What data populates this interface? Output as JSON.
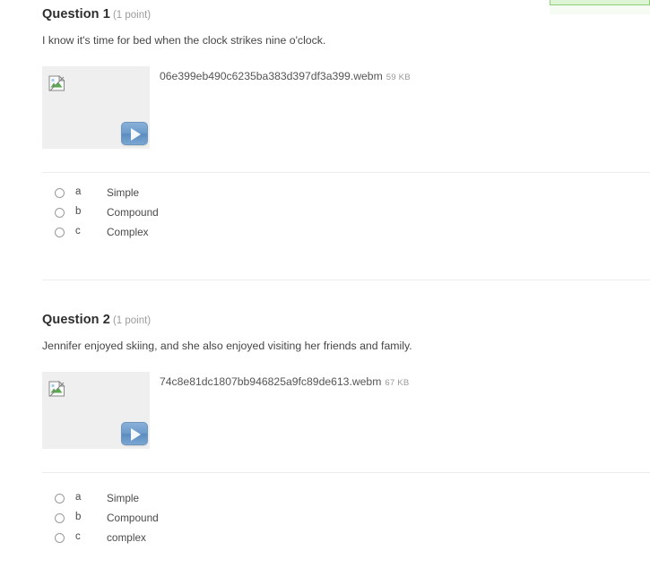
{
  "banner": {
    "color": "#ddf5d4",
    "border_color": "#8fce79"
  },
  "questions": [
    {
      "title": "Question 1",
      "points": "(1 point)",
      "prompt": "I know it's time for bed when the clock strikes nine o'clock.",
      "attachment": {
        "file_name": "06e399eb490c6235ba383d397df3a399.webm",
        "file_size": "59 KB",
        "thumbnail_icon": "broken-image-icon",
        "play_icon": "play-icon"
      },
      "options": [
        {
          "letter": "a",
          "text": "Simple",
          "selected": false
        },
        {
          "letter": "b",
          "text": "Compound",
          "selected": false
        },
        {
          "letter": "c",
          "text": "Complex",
          "selected": false
        }
      ]
    },
    {
      "title": "Question 2",
      "points": "(1 point)",
      "prompt": "Jennifer enjoyed skiing, and she also enjoyed visiting her friends and family.",
      "attachment": {
        "file_name": "74c8e81dc1807bb946825a9fc89de613.webm",
        "file_size": "67 KB",
        "thumbnail_icon": "broken-image-icon",
        "play_icon": "play-icon"
      },
      "options": [
        {
          "letter": "a",
          "text": "Simple",
          "selected": false
        },
        {
          "letter": "b",
          "text": "Compound",
          "selected": false
        },
        {
          "letter": "c",
          "text": "complex",
          "selected": false
        }
      ]
    }
  ]
}
